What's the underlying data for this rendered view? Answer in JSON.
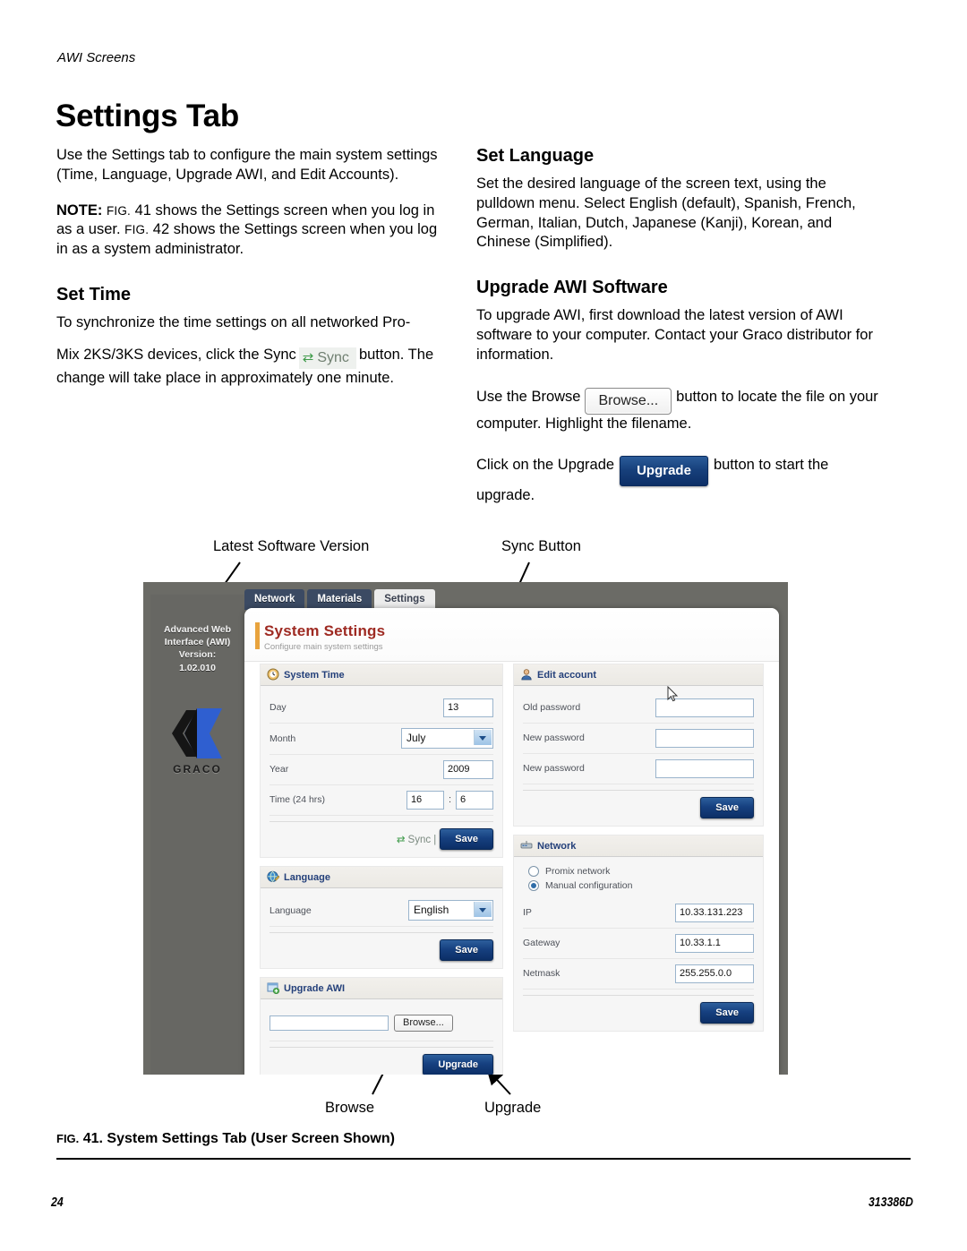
{
  "header": {
    "running_head": "AWI Screens",
    "page_title": "Settings Tab"
  },
  "left_column": {
    "intro": "Use the Settings tab to configure the main system settings (Time, Language, Upgrade AWI, and Edit Accounts).",
    "note_label": "NOTE:",
    "note_fig1": "FIG.",
    "note_text1": " 41 shows the Settings screen when you log in as a user. ",
    "note_fig2": "FIG.",
    "note_text2": " 42 shows the Settings screen when you log in as a system administrator.",
    "set_time_heading": "Set Time",
    "set_time_p1": "To synchronize the time settings on all networked Pro-",
    "set_time_p2a": "Mix 2KS/3KS devices, click the Sync",
    "sync_inline_label": "Sync",
    "sync_inline_icon": "sync-arrows-icon",
    "set_time_p2b": "button. The change will take place in approximately one minute."
  },
  "right_column": {
    "set_language_heading": "Set Language",
    "set_language_body": "Set the desired language of the screen text, using the pulldown menu. Select English (default), Spanish, French, German, Italian, Dutch, Japanese (Kanji), Korean, and Chinese (Simplified).",
    "upgrade_heading": "Upgrade AWI Software",
    "upgrade_body": "To upgrade AWI, first download the latest version of AWI software to your computer. Contact your Graco distributor for information.",
    "browse_p_a": "Use the Browse",
    "browse_inline_label": "Browse...",
    "browse_p_b": "button to locate the file on your computer. Highlight the filename.",
    "upgrade_p_a": "Click on the Upgrade",
    "upgrade_inline_label": "Upgrade",
    "upgrade_p_b": "button to start the upgrade."
  },
  "callouts": {
    "latest_software_version": "Latest Software Version",
    "sync_button": "Sync Button",
    "browse": "Browse",
    "upgrade": "Upgrade"
  },
  "screenshot": {
    "sidebar": {
      "line1": "Advanced Web",
      "line2": "Interface (AWI)",
      "line3": "Version:",
      "version": "1.02.010",
      "logo_word": "GRACO",
      "logo_icon": "graco-g-logo-icon"
    },
    "tabs": [
      {
        "label": "Network",
        "active": false
      },
      {
        "label": "Materials",
        "active": false
      },
      {
        "label": "Settings",
        "active": true
      }
    ],
    "page_header": {
      "title": "System Settings",
      "subtitle": "Configure main system settings"
    },
    "panels": {
      "system_time": {
        "title": "System Time",
        "icon": "clock-icon",
        "rows": [
          {
            "label": "Day",
            "value": "13",
            "type": "text"
          },
          {
            "label": "Month",
            "value": "July",
            "type": "select"
          },
          {
            "label": "Year",
            "value": "2009",
            "type": "text"
          }
        ],
        "time_label": "Time (24 hrs)",
        "time_hours": "16",
        "time_separator": ":",
        "time_minutes": "6",
        "sync_label": "Sync |",
        "sync_icon": "sync-arrows-icon",
        "save_label": "Save"
      },
      "language": {
        "title": "Language",
        "icon": "globe-pencil-icon",
        "row_label": "Language",
        "value": "English",
        "save_label": "Save"
      },
      "upgrade_awi": {
        "title": "Upgrade AWI",
        "icon": "upload-window-icon",
        "file_value": "",
        "browse_label": "Browse...",
        "upgrade_label": "Upgrade"
      },
      "edit_account": {
        "title": "Edit account",
        "icon": "user-icon",
        "rows": [
          {
            "label": "Old password",
            "value": ""
          },
          {
            "label": "New password",
            "value": ""
          },
          {
            "label": "New password",
            "value": ""
          }
        ],
        "save_label": "Save"
      },
      "network": {
        "title": "Network",
        "icon": "network-device-icon",
        "options": [
          {
            "label": "Promix network",
            "selected": false
          },
          {
            "label": "Manual configuration",
            "selected": true
          }
        ],
        "rows": [
          {
            "label": "IP",
            "value": "10.33.131.223"
          },
          {
            "label": "Gateway",
            "value": "10.33.1.1"
          },
          {
            "label": "Netmask",
            "value": "255.255.0.0"
          }
        ],
        "save_label": "Save"
      }
    },
    "cursor_icon": "mouse-pointer-icon"
  },
  "figure_caption": {
    "fig": "FIG.",
    "text": " 41. System Settings Tab (User Screen Shown)"
  },
  "footer": {
    "page_number": "24",
    "doc_number": "313386D"
  },
  "colors": {
    "heading_red": "#9e2a22",
    "accent_orange": "#e8a33d",
    "tab_blue": "#3b4a63",
    "button_blue": "#164080",
    "sidebar_gray": "#676763",
    "figure_bg": "#6b6b66"
  }
}
